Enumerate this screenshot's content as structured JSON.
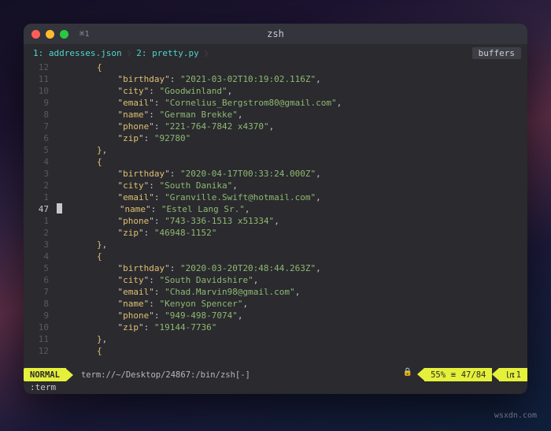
{
  "window": {
    "tab_hint": "⌘1",
    "title": "zsh"
  },
  "tabs": {
    "t1": "1: addresses.json",
    "t2": "2: pretty.py",
    "glyph": "❯",
    "buffers": "buffers"
  },
  "gutter": [
    "12",
    "11",
    "10",
    "9",
    "8",
    "7",
    "6",
    "5",
    "4",
    "3",
    "2",
    "1",
    "47",
    "1",
    "2",
    "3",
    "4",
    "5",
    "6",
    "7",
    "8",
    "9",
    "10",
    "11",
    "12"
  ],
  "cursor_row_index": 12,
  "records": [
    {
      "birthday": "2021-03-02T10:19:02.116Z",
      "city": "Goodwinland",
      "email": "Cornelius_Bergstrom80@gmail.com",
      "name": "German Brekke",
      "phone": "221-764-7842 x4370",
      "zip": "92780"
    },
    {
      "birthday": "2020-04-17T00:33:24.000Z",
      "city": "South Danika",
      "email": "Granville.Swift@hotmail.com",
      "name": "Estel Lang Sr.",
      "phone": "743-336-1513 x51334",
      "zip": "46948-1152"
    },
    {
      "birthday": "2020-03-20T20:48:44.263Z",
      "city": "South Davidshire",
      "email": "Chad.Marvin98@gmail.com",
      "name": "Kenyon Spencer",
      "phone": "949-498-7074",
      "zip": "19144-7736"
    }
  ],
  "display_rows": [
    {
      "indent": 2,
      "type": "open"
    },
    {
      "indent": 3,
      "type": "kv",
      "rec": 0,
      "key": "birthday"
    },
    {
      "indent": 3,
      "type": "kv",
      "rec": 0,
      "key": "city"
    },
    {
      "indent": 3,
      "type": "kv",
      "rec": 0,
      "key": "email"
    },
    {
      "indent": 3,
      "type": "kv",
      "rec": 0,
      "key": "name"
    },
    {
      "indent": 3,
      "type": "kv",
      "rec": 0,
      "key": "phone"
    },
    {
      "indent": 3,
      "type": "kv",
      "rec": 0,
      "key": "zip",
      "last": true
    },
    {
      "indent": 2,
      "type": "close"
    },
    {
      "indent": 2,
      "type": "open"
    },
    {
      "indent": 3,
      "type": "kv",
      "rec": 1,
      "key": "birthday"
    },
    {
      "indent": 3,
      "type": "kv",
      "rec": 1,
      "key": "city"
    },
    {
      "indent": 3,
      "type": "kv",
      "rec": 1,
      "key": "email"
    },
    {
      "indent": 3,
      "type": "kv",
      "rec": 1,
      "key": "name",
      "cursor": true
    },
    {
      "indent": 3,
      "type": "kv",
      "rec": 1,
      "key": "phone"
    },
    {
      "indent": 3,
      "type": "kv",
      "rec": 1,
      "key": "zip",
      "last": true
    },
    {
      "indent": 2,
      "type": "close"
    },
    {
      "indent": 2,
      "type": "open"
    },
    {
      "indent": 3,
      "type": "kv",
      "rec": 2,
      "key": "birthday"
    },
    {
      "indent": 3,
      "type": "kv",
      "rec": 2,
      "key": "city"
    },
    {
      "indent": 3,
      "type": "kv",
      "rec": 2,
      "key": "email"
    },
    {
      "indent": 3,
      "type": "kv",
      "rec": 2,
      "key": "name"
    },
    {
      "indent": 3,
      "type": "kv",
      "rec": 2,
      "key": "phone"
    },
    {
      "indent": 3,
      "type": "kv",
      "rec": 2,
      "key": "zip",
      "last": true
    },
    {
      "indent": 2,
      "type": "close"
    },
    {
      "indent": 2,
      "type": "open"
    }
  ],
  "status": {
    "mode": "NORMAL",
    "termname": "term://~/Desktop/24867:/bin/zsh[-]",
    "lock_icon": "🔒",
    "percent": "55%",
    "line_col_glyph": "≡",
    "position": "47/84",
    "col_glyph": "㏑",
    "column": ":1"
  },
  "cmdline": ":term",
  "watermark": "wsxdn.com"
}
